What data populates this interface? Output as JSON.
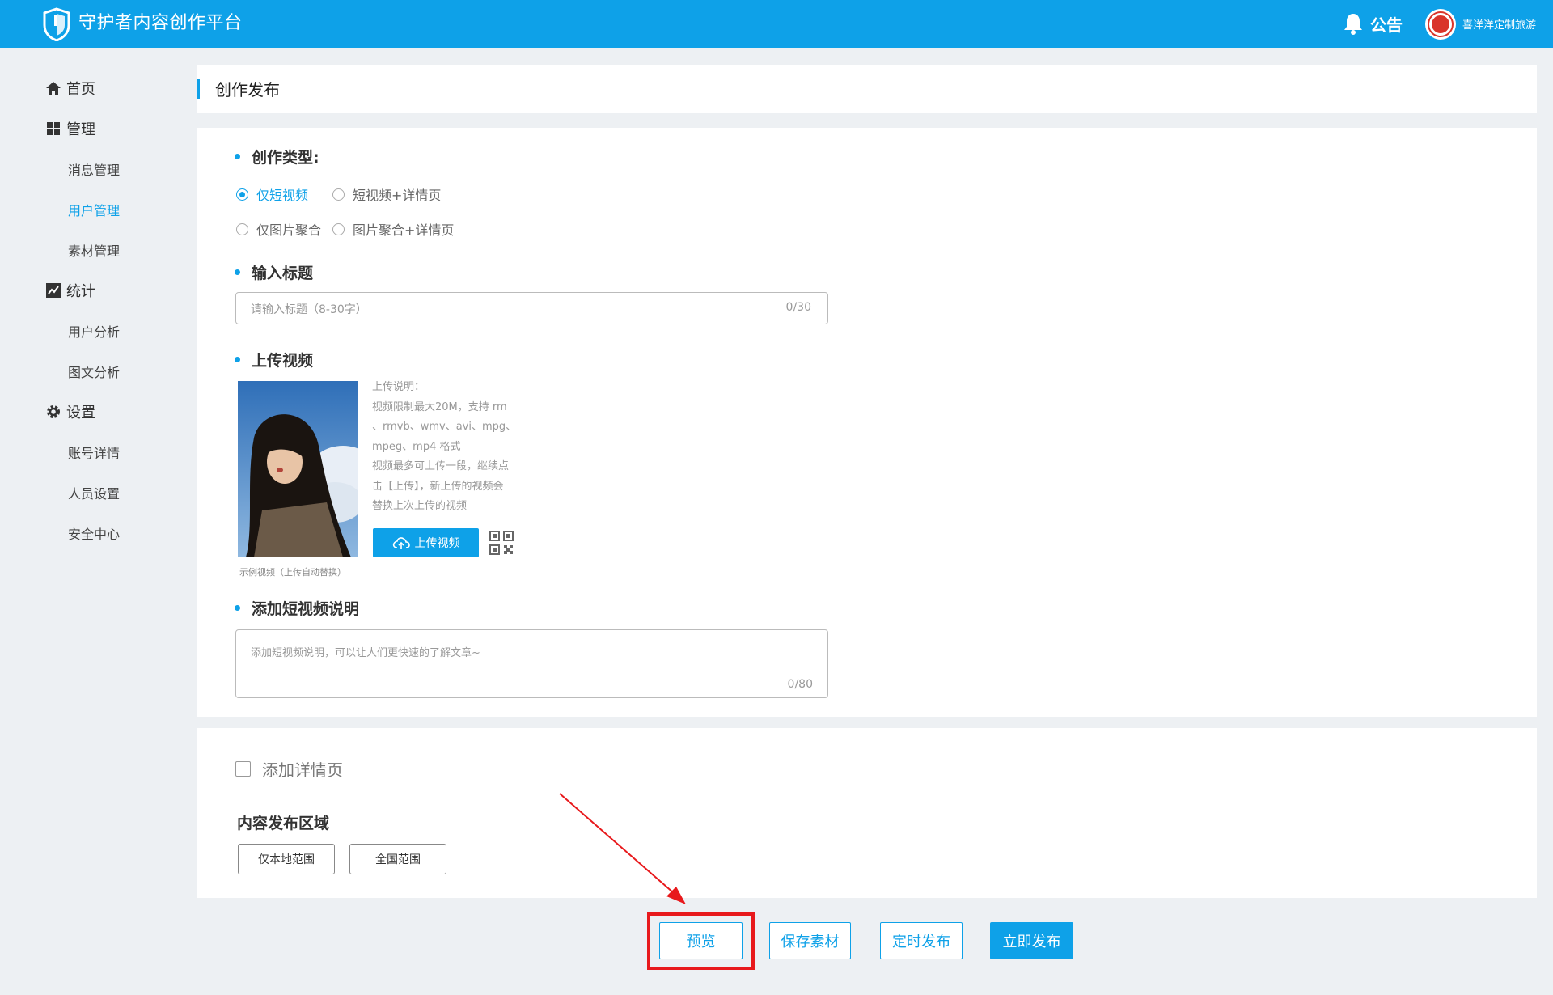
{
  "header": {
    "brand": "守护者内容创作平台",
    "notice_label": "公告",
    "username": "喜洋洋定制旅游",
    "brand_color": "#0ea1e8"
  },
  "sidebar": {
    "items": [
      {
        "label": "首页",
        "icon": "home-icon"
      },
      {
        "label": "管理",
        "icon": "grid-icon"
      },
      {
        "label": "消息管理"
      },
      {
        "label": "用户管理",
        "active": true
      },
      {
        "label": "素材管理"
      },
      {
        "label": "统计",
        "icon": "chart-icon"
      },
      {
        "label": "用户分析"
      },
      {
        "label": "图文分析"
      },
      {
        "label": "设置",
        "icon": "gear-icon"
      },
      {
        "label": "账号详情"
      },
      {
        "label": "人员设置"
      },
      {
        "label": "安全中心"
      }
    ]
  },
  "page": {
    "title": "创作发布"
  },
  "form": {
    "type_label": "创作类型:",
    "type_options": [
      "仅短视频",
      "短视频+详情页",
      "仅图片聚合",
      "图片聚合+详情页"
    ],
    "type_selected": "仅短视频",
    "title_label": "输入标题",
    "title_placeholder": "请输入标题（8-30字）",
    "title_count": "0/30",
    "upload_label": "上传视频",
    "upload_desc": [
      "上传说明：",
      "视频限制最大20M，支持 rm",
      "、rmvb、wmv、avi、mpg、",
      "mpeg、mp4 格式",
      "视频最多可上传一段，继续点",
      "击【上传】，新上传的视频会",
      "替换上次上传的视频"
    ],
    "upload_button": "上传视频",
    "thumb_caption": "示例视频（上传自动替换）",
    "desc_label": "添加短视频说明",
    "desc_placeholder": "添加短视频说明，可以让人们更快速的了解文章~",
    "desc_count": "0/80",
    "detail_checkbox": "添加详情页",
    "region_title": "内容发布区域",
    "region_options": [
      "仅本地范围",
      "全国范围"
    ]
  },
  "actions": {
    "preview": "预览",
    "save": "保存素材",
    "schedule": "定时发布",
    "publish": "立即发布"
  }
}
